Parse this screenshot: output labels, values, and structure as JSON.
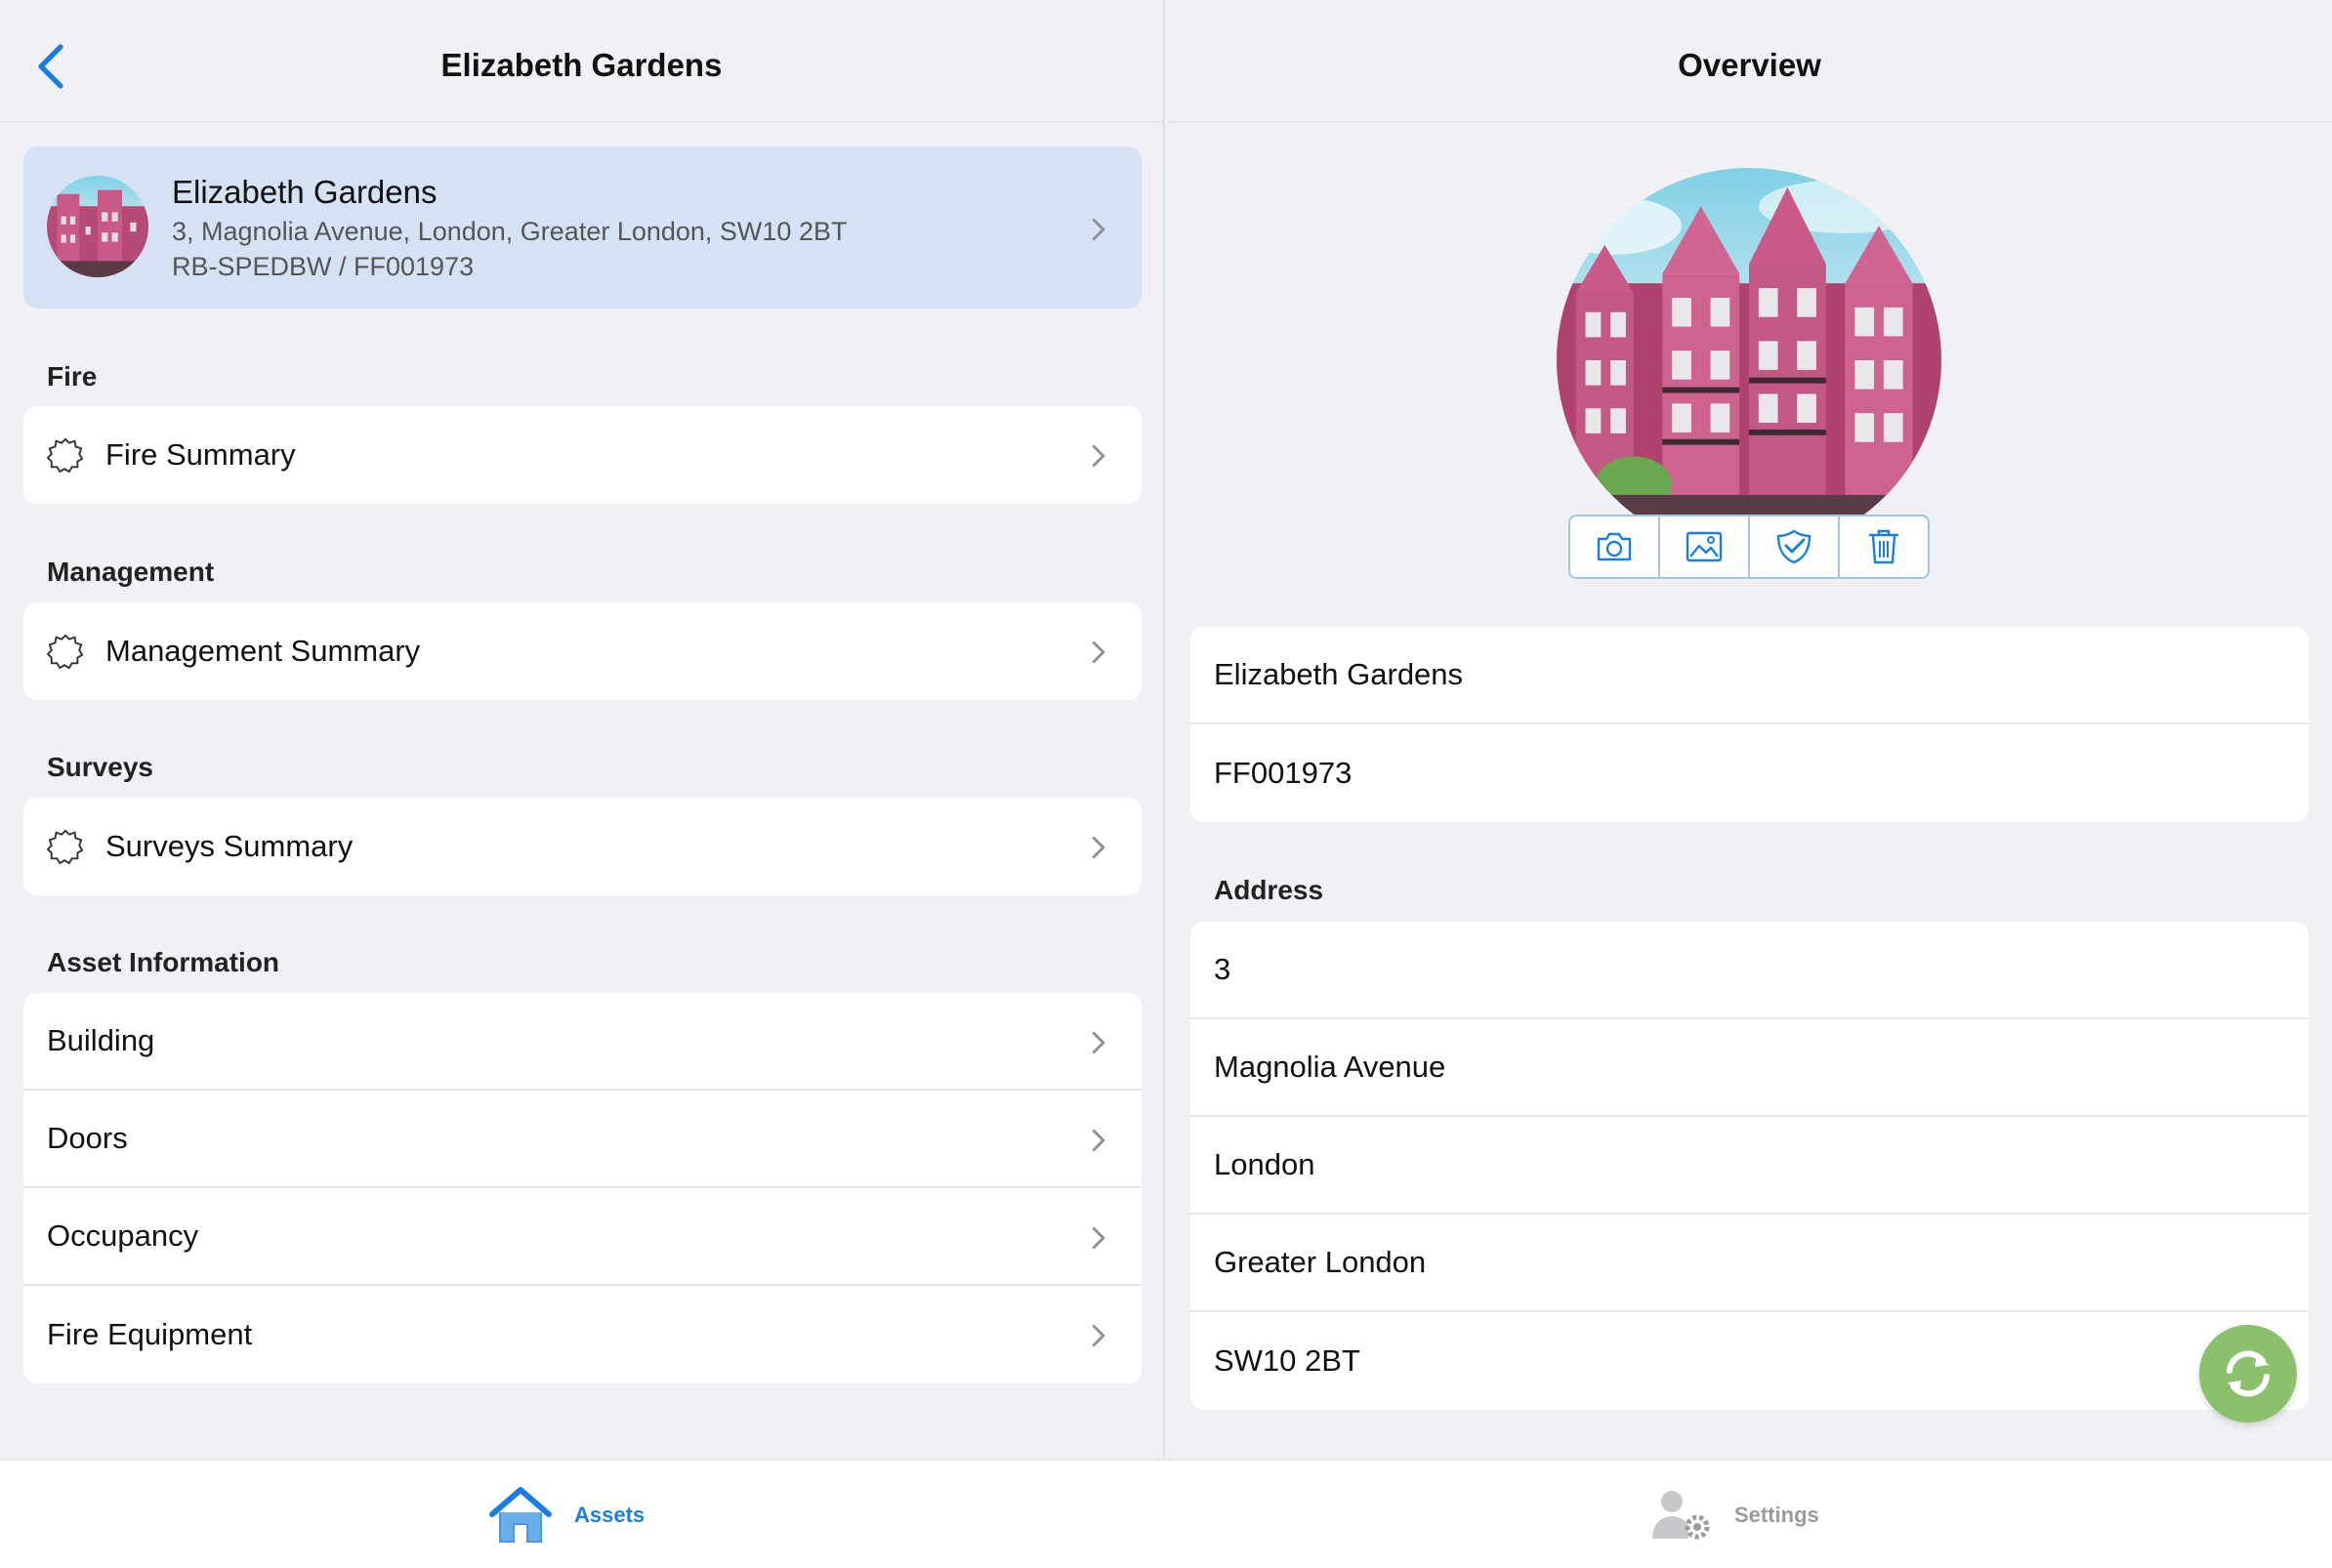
{
  "left_header": {
    "title": "Elizabeth Gardens",
    "back_icon": "chevron-left-icon"
  },
  "asset": {
    "name": "Elizabeth Gardens",
    "address": "3, Magnolia Avenue, London, Greater London, SW10 2BT",
    "reference": "RB-SPEDBW / FF001973"
  },
  "sections": {
    "fire": {
      "label": "Fire",
      "item": "Fire Summary"
    },
    "management": {
      "label": "Management",
      "item": "Management Summary"
    },
    "surveys": {
      "label": "Surveys",
      "item": "Surveys Summary"
    },
    "asset_info": {
      "label": "Asset Information",
      "items": [
        "Building",
        "Doors",
        "Occupancy",
        "Fire Equipment"
      ]
    }
  },
  "right_header": {
    "title": "Overview"
  },
  "photo_actions": [
    "camera-icon",
    "image-icon",
    "verified-shield-icon",
    "trash-icon"
  ],
  "overview": {
    "name": "Elizabeth Gardens",
    "code": "FF001973",
    "address_label": "Address",
    "address_lines": [
      "3",
      "Magnolia Avenue",
      "London",
      "Greater London",
      "SW10 2BT"
    ]
  },
  "tabs": [
    {
      "label": "Assets",
      "icon": "home-icon",
      "active": true
    },
    {
      "label": "Settings",
      "icon": "user-settings-icon",
      "active": false
    }
  ],
  "colors": {
    "accent": "#1a7ee0",
    "selected_row": "#d5e2f4",
    "sync_button": "#8bc06c",
    "inactive_tab": "#9a9a9f"
  }
}
